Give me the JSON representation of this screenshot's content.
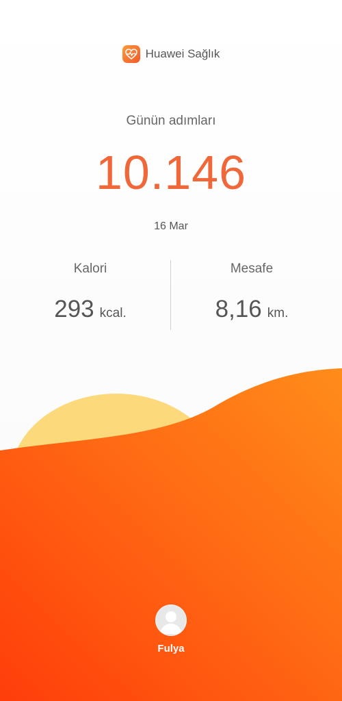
{
  "app": {
    "name": "Huawei Sağlık",
    "icon": "health-heart-icon",
    "icon_color": "#f2582a"
  },
  "steps": {
    "label": "Günün adımları",
    "value": "10.146",
    "date": "16 Mar"
  },
  "stats": {
    "calories": {
      "label": "Kalori",
      "value": "293",
      "unit": "kcal."
    },
    "distance": {
      "label": "Mesafe",
      "value": "8,16",
      "unit": "km."
    }
  },
  "user": {
    "name": "Fulya",
    "avatar_icon": "person-avatar-icon"
  },
  "colors": {
    "accent": "#f0673a",
    "wave_dark": "#ff4a10",
    "wave_light": "#ff8c1a",
    "sun": "#fcd97a"
  }
}
